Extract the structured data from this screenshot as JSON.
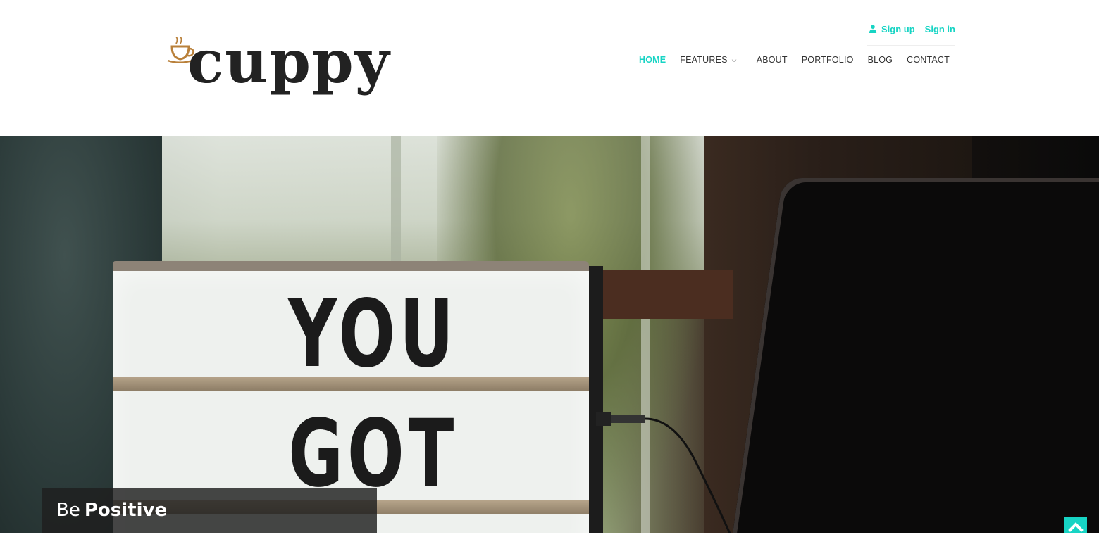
{
  "brand": {
    "logo_text": "cuppy",
    "accent_color": "#17d4c4",
    "logo_cup_color": "#b9803a"
  },
  "auth": {
    "signup_label": "Sign up",
    "signin_label": "Sign in",
    "user_icon": "user-icon"
  },
  "nav": {
    "items": [
      {
        "label": "HOME",
        "active": true
      },
      {
        "label": "FEATURES",
        "has_dropdown": true
      },
      {
        "label": "ABOUT"
      },
      {
        "label": "PORTFOLIO"
      },
      {
        "label": "BLOG"
      },
      {
        "label": "CONTACT"
      }
    ],
    "dropdown_icon": "chevron-down-icon"
  },
  "hero": {
    "lightbox_words": [
      "YOU",
      "GOT"
    ],
    "caption": {
      "light": "Be",
      "bold": "Positive"
    }
  },
  "scroll_top": {
    "icon": "chevron-up-icon"
  }
}
